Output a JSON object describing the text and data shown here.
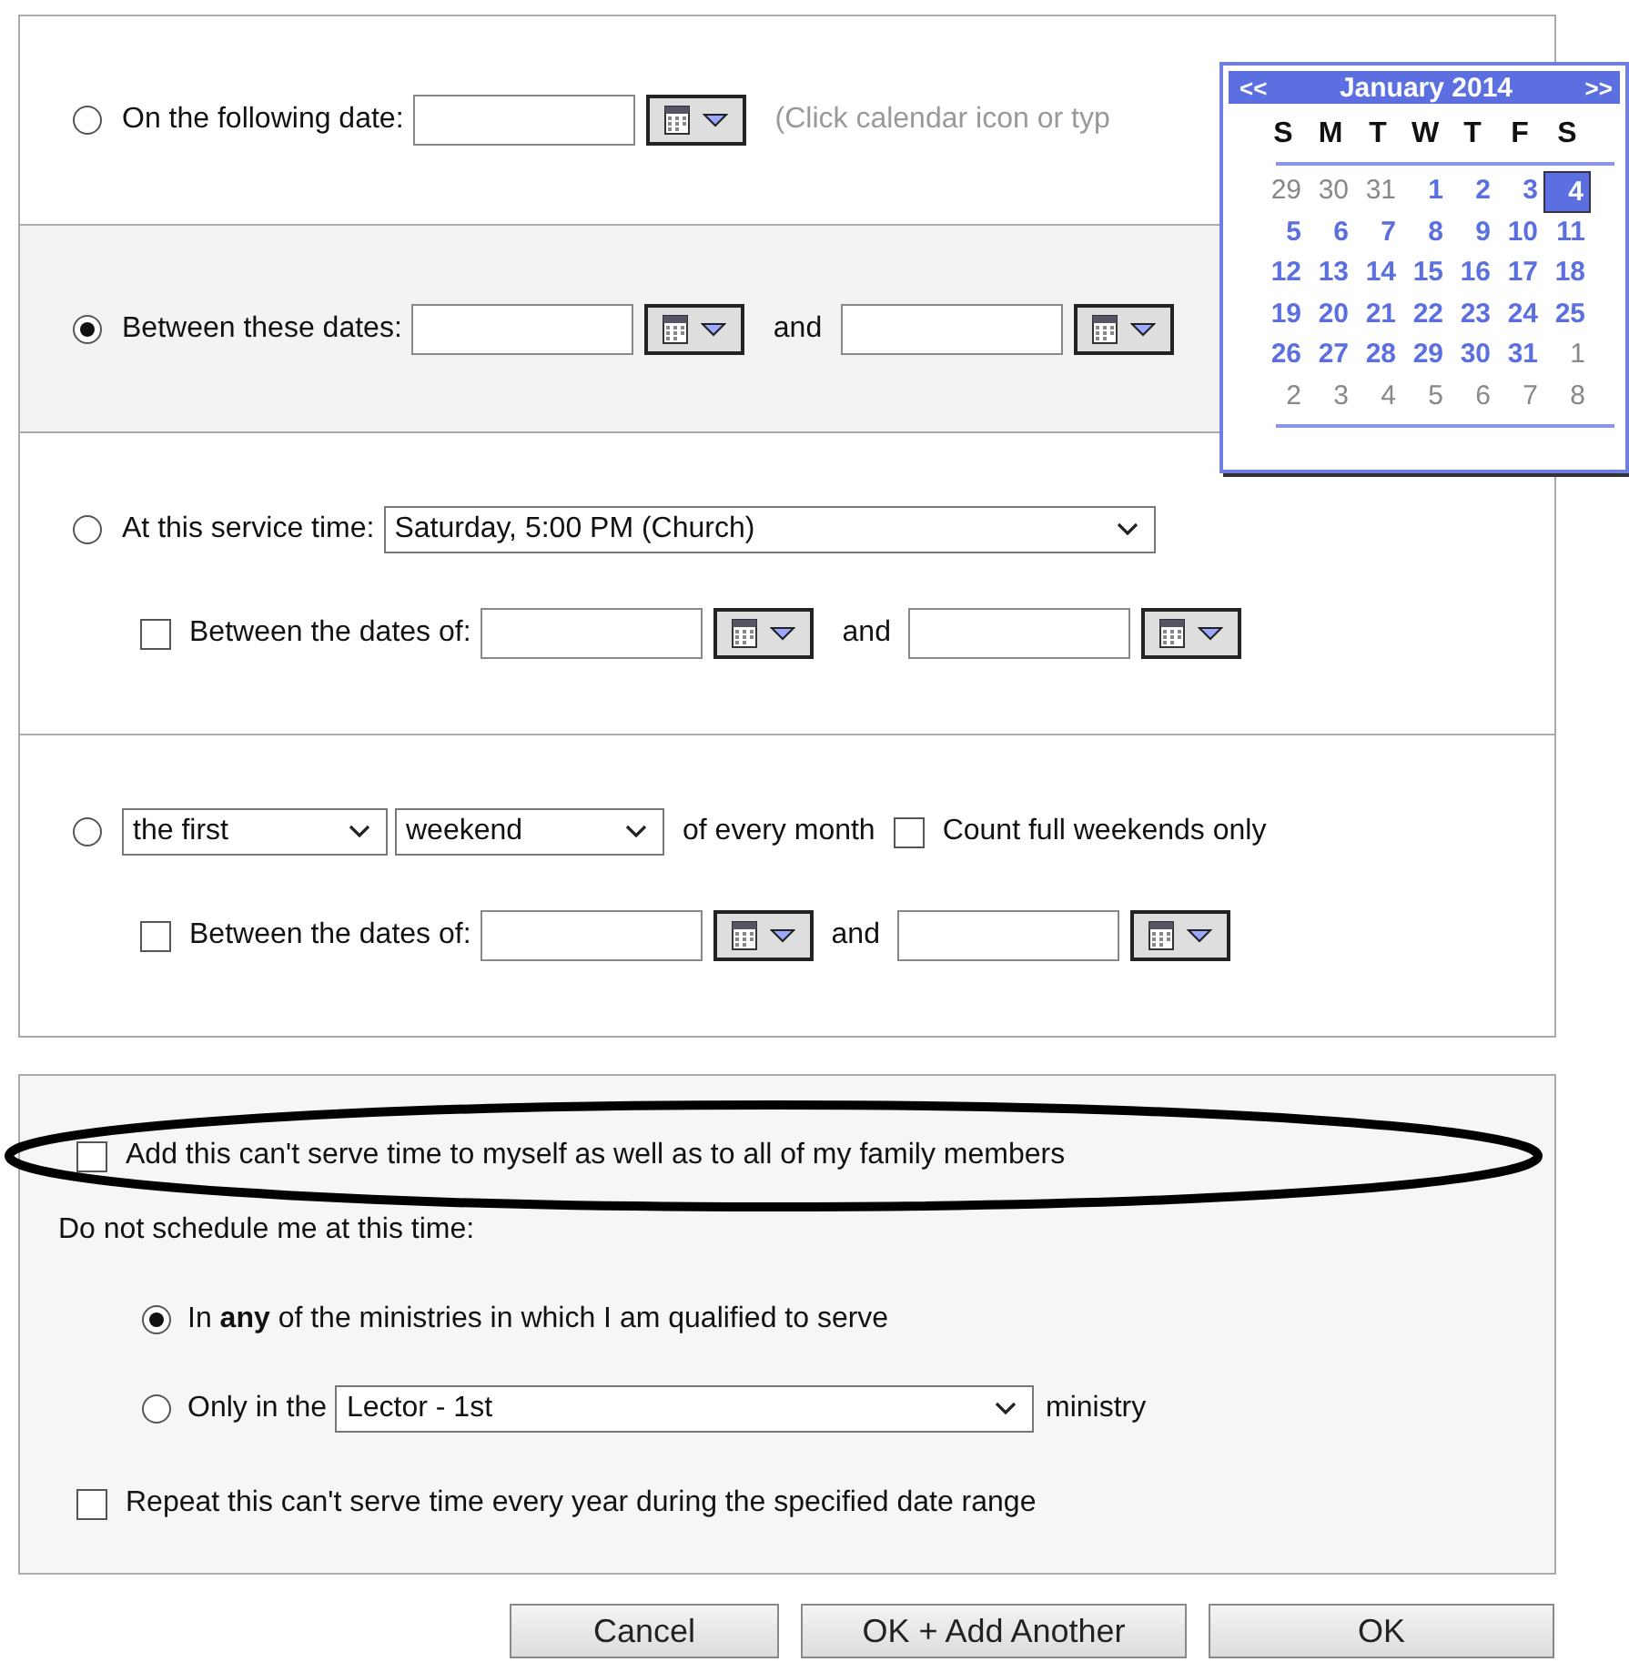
{
  "sections": [
    {
      "kind": "date",
      "selected": false,
      "label": "On the following date:",
      "hint": "(Click calendar icon or typ"
    },
    {
      "kind": "range",
      "selected": true,
      "label": "Between these dates:",
      "and": "and"
    },
    {
      "kind": "service",
      "selected": false,
      "label": "At this service time:",
      "select": "Saturday, 5:00 PM (Church)",
      "range": {
        "checked": false,
        "label": "Between the dates of:",
        "and": "and"
      }
    },
    {
      "kind": "monthly",
      "selected": false,
      "ordinal": "the first",
      "unit": "weekend",
      "suffix": "of every month",
      "full_weekends": {
        "checked": false,
        "label": "Count full weekends only"
      },
      "range": {
        "checked": false,
        "label": "Between the dates of:",
        "and": "and"
      }
    }
  ],
  "options": {
    "family": {
      "checked": false,
      "label": "Add this can't serve time to myself as well as to all of my family members"
    },
    "prompt": "Do not schedule me at this time:",
    "ministry_choices": [
      {
        "kind": "any",
        "selected": true,
        "label": "In **any** of the ministries in which I am qualified to serve"
      },
      {
        "kind": "only",
        "selected": false,
        "label": "Only in the",
        "select": "Lector - 1st",
        "suffix": "ministry"
      }
    ],
    "repeat": {
      "checked": false,
      "label": "Repeat this can't serve time every year during the specified date range"
    }
  },
  "buttons": [
    "Cancel",
    "OK + Add Another",
    "OK"
  ],
  "calendar": {
    "prev": "<<",
    "title": "January 2014",
    "next": ">>",
    "weekdays": [
      "S",
      "M",
      "T",
      "W",
      "T",
      "F",
      "S"
    ],
    "weeks": [
      [
        {
          "d": "29",
          "other": true,
          "selected": false
        },
        {
          "d": "30",
          "other": true,
          "selected": false
        },
        {
          "d": "31",
          "other": true,
          "selected": false
        },
        {
          "d": "1",
          "other": false,
          "selected": false
        },
        {
          "d": "2",
          "other": false,
          "selected": false
        },
        {
          "d": "3",
          "other": false,
          "selected": false
        },
        {
          "d": "4",
          "other": false,
          "selected": true
        }
      ],
      [
        {
          "d": "5",
          "other": false,
          "selected": false
        },
        {
          "d": "6",
          "other": false,
          "selected": false
        },
        {
          "d": "7",
          "other": false,
          "selected": false
        },
        {
          "d": "8",
          "other": false,
          "selected": false
        },
        {
          "d": "9",
          "other": false,
          "selected": false
        },
        {
          "d": "10",
          "other": false,
          "selected": false
        },
        {
          "d": "11",
          "other": false,
          "selected": false
        }
      ],
      [
        {
          "d": "12",
          "other": false,
          "selected": false
        },
        {
          "d": "13",
          "other": false,
          "selected": false
        },
        {
          "d": "14",
          "other": false,
          "selected": false
        },
        {
          "d": "15",
          "other": false,
          "selected": false
        },
        {
          "d": "16",
          "other": false,
          "selected": false
        },
        {
          "d": "17",
          "other": false,
          "selected": false
        },
        {
          "d": "18",
          "other": false,
          "selected": false
        }
      ],
      [
        {
          "d": "19",
          "other": false,
          "selected": false
        },
        {
          "d": "20",
          "other": false,
          "selected": false
        },
        {
          "d": "21",
          "other": false,
          "selected": false
        },
        {
          "d": "22",
          "other": false,
          "selected": false
        },
        {
          "d": "23",
          "other": false,
          "selected": false
        },
        {
          "d": "24",
          "other": false,
          "selected": false
        },
        {
          "d": "25",
          "other": false,
          "selected": false
        }
      ],
      [
        {
          "d": "26",
          "other": false,
          "selected": false
        },
        {
          "d": "27",
          "other": false,
          "selected": false
        },
        {
          "d": "28",
          "other": false,
          "selected": false
        },
        {
          "d": "29",
          "other": false,
          "selected": false
        },
        {
          "d": "30",
          "other": false,
          "selected": false
        },
        {
          "d": "31",
          "other": false,
          "selected": false
        },
        {
          "d": "1",
          "other": true,
          "selected": false
        }
      ],
      [
        {
          "d": "2",
          "other": true,
          "selected": false
        },
        {
          "d": "3",
          "other": true,
          "selected": false
        },
        {
          "d": "4",
          "other": true,
          "selected": false
        },
        {
          "d": "5",
          "other": true,
          "selected": false
        },
        {
          "d": "6",
          "other": true,
          "selected": false
        },
        {
          "d": "7",
          "other": true,
          "selected": false
        },
        {
          "d": "8",
          "other": true,
          "selected": false
        }
      ]
    ]
  }
}
